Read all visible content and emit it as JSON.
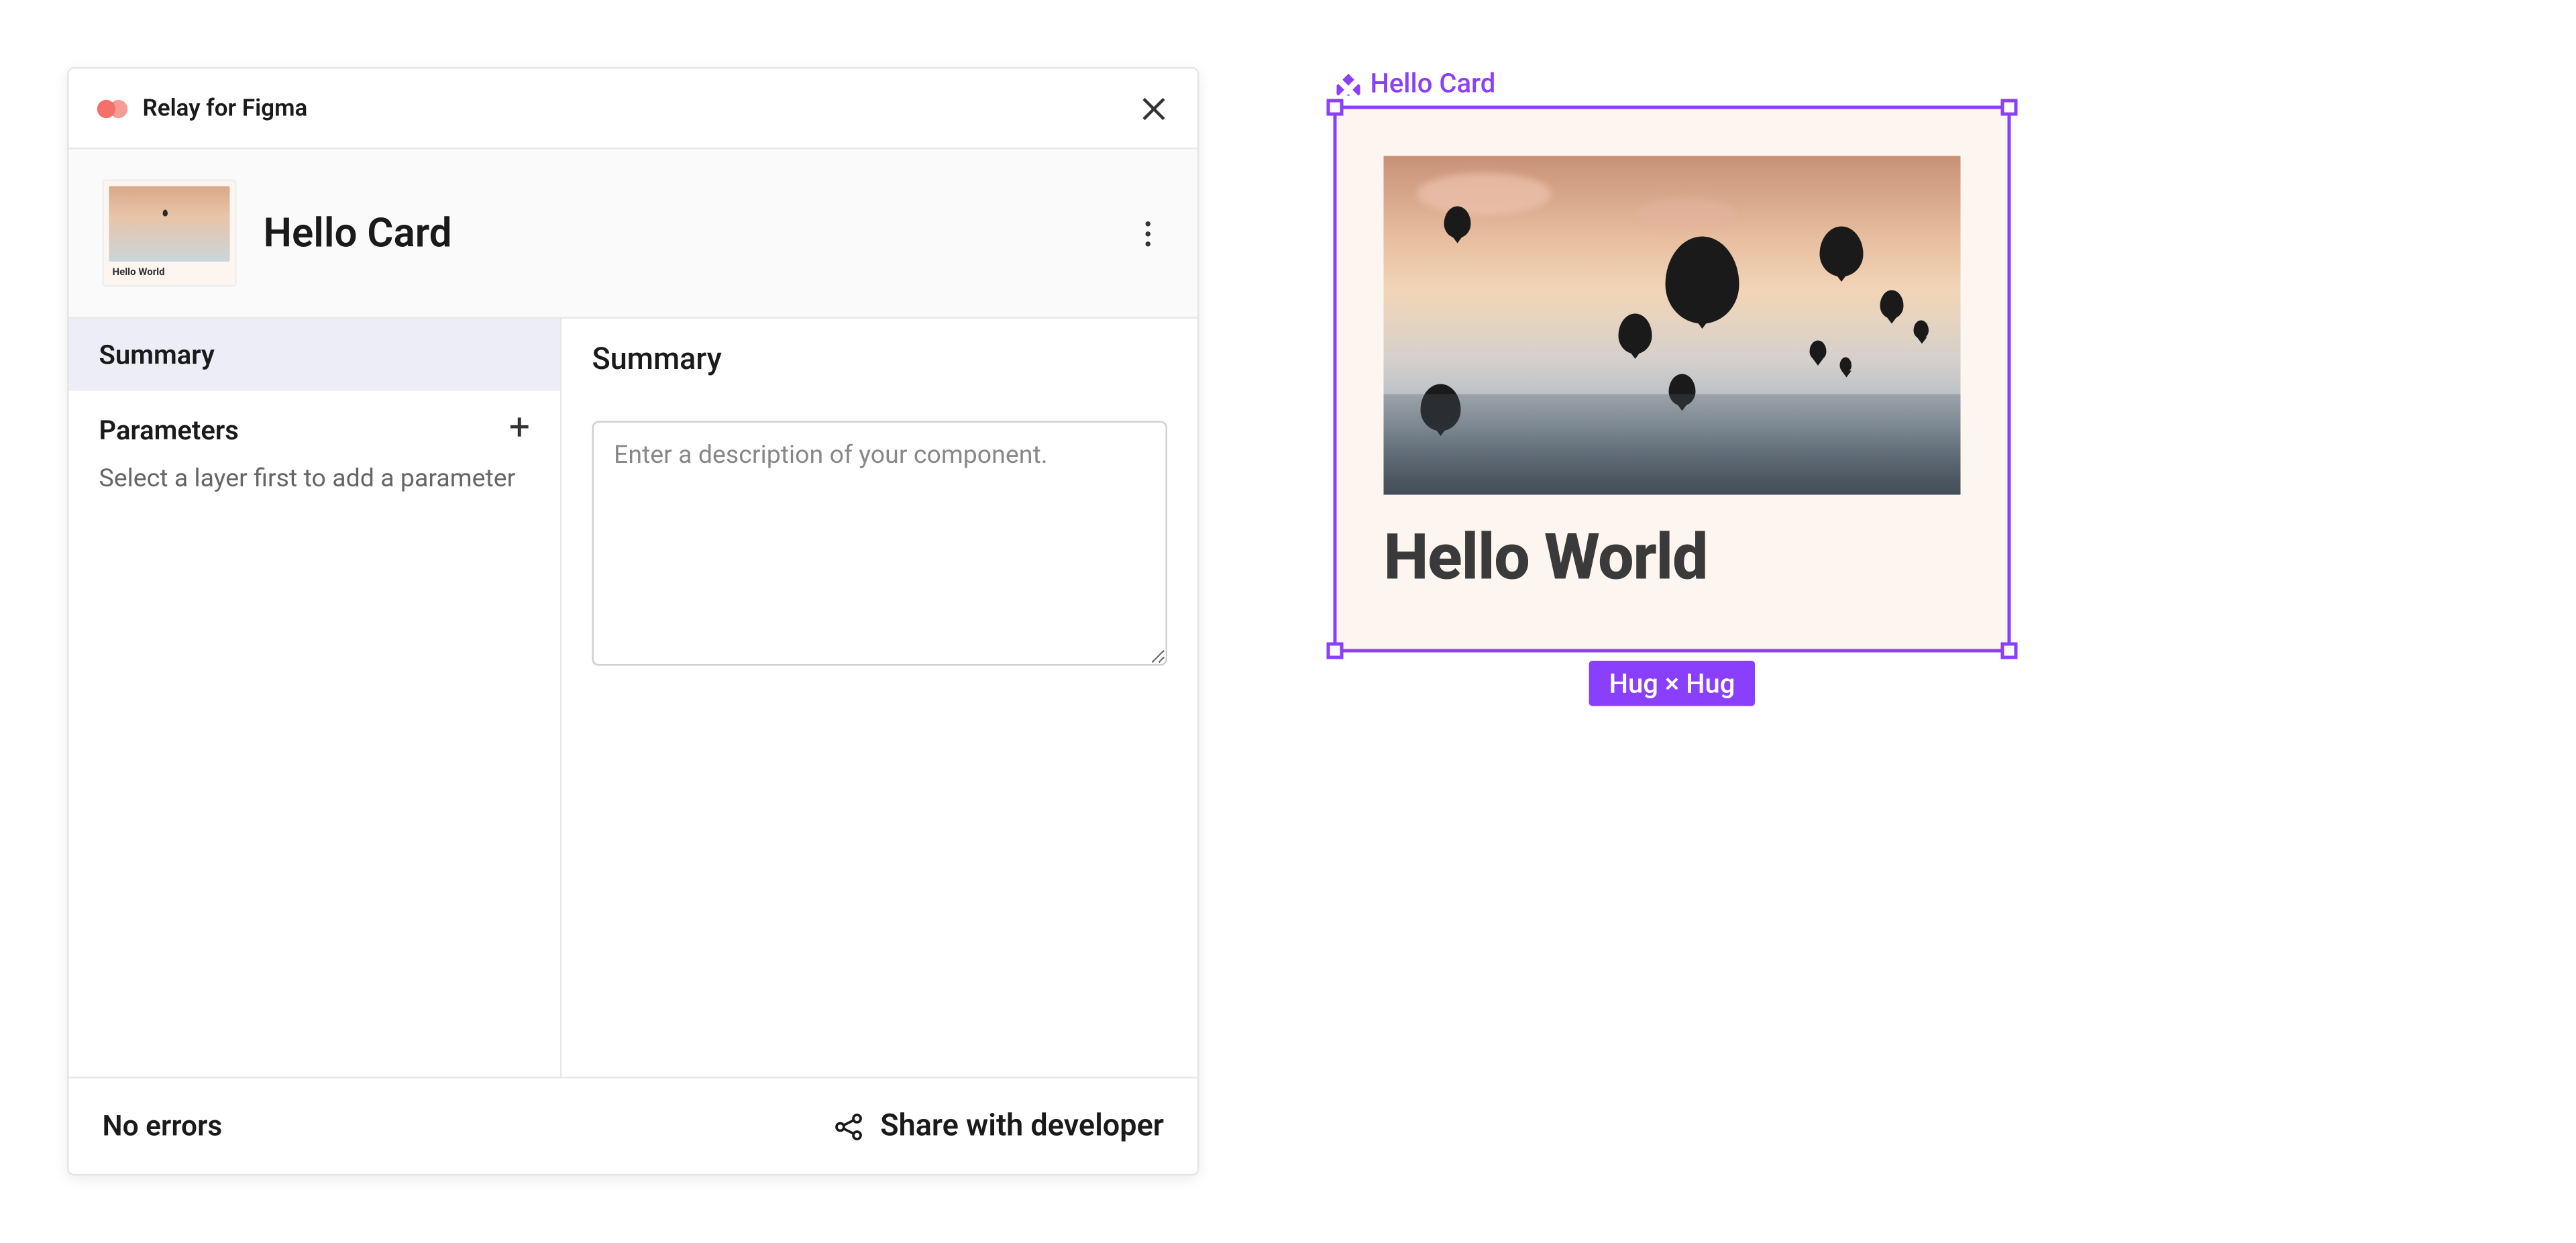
{
  "plugin": {
    "title": "Relay for Figma",
    "component_name": "Hello Card",
    "thumb_text": "Hello World"
  },
  "sidebar": {
    "tabs": [
      {
        "label": "Summary",
        "active": true
      }
    ],
    "parameters": {
      "title": "Parameters",
      "help_text": "Select a layer first to add a parameter"
    }
  },
  "content": {
    "heading": "Summary",
    "description_placeholder": "Enter a description of your component.",
    "description_value": ""
  },
  "footer": {
    "status": "No errors",
    "share_label": "Share with developer"
  },
  "canvas": {
    "component_label": "Hello Card",
    "card_text": "Hello World",
    "size_badge": "Hug × Hug"
  },
  "colors": {
    "accent": "#8a3ffc",
    "relay_pink": "#f47068"
  }
}
